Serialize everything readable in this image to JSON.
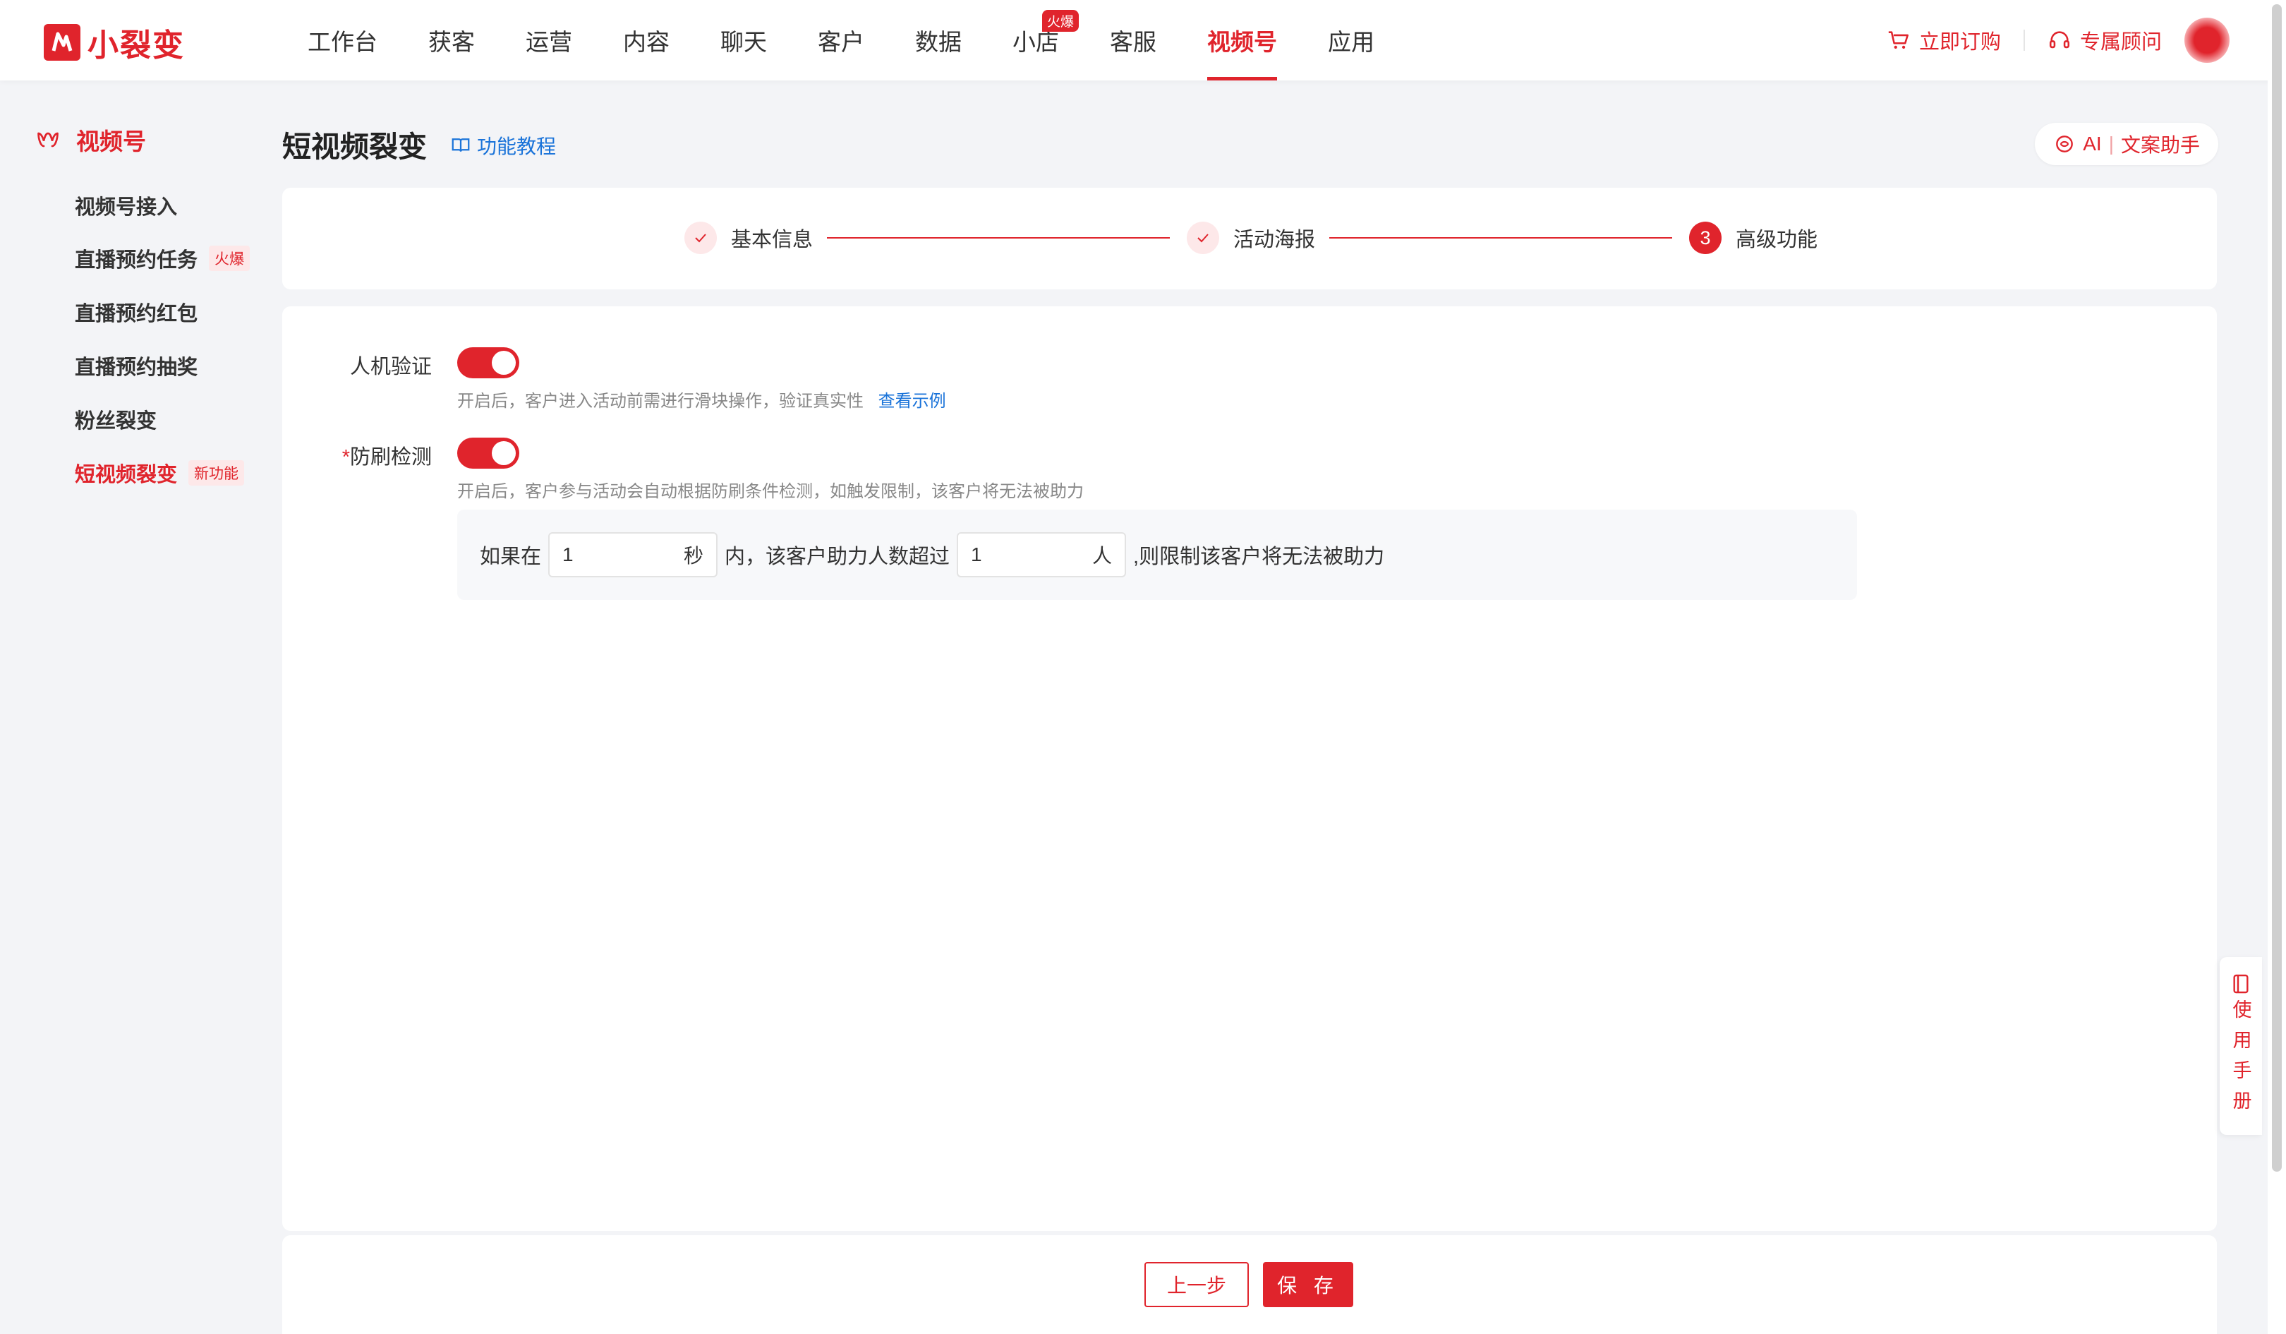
{
  "brand": {
    "name": "小裂变",
    "color": "#e0242c"
  },
  "nav": {
    "items": [
      "工作台",
      "获客",
      "运营",
      "内容",
      "聊天",
      "客户",
      "数据",
      "小店",
      "客服",
      "视频号",
      "应用"
    ],
    "active": "视频号",
    "shop_badge": "火爆"
  },
  "header": {
    "buy_label": "立即订购",
    "advisor_label": "专属顾问"
  },
  "sidebar": {
    "title": "视频号",
    "items": [
      {
        "label": "视频号接入",
        "tag": ""
      },
      {
        "label": "直播预约任务",
        "tag": "火爆"
      },
      {
        "label": "直播预约红包",
        "tag": ""
      },
      {
        "label": "直播预约抽奖",
        "tag": ""
      },
      {
        "label": "粉丝裂变",
        "tag": ""
      },
      {
        "label": "短视频裂变",
        "tag": "新功能"
      }
    ],
    "active_index": 5
  },
  "page": {
    "title": "短视频裂变",
    "tutorial_label": "功能教程",
    "ai_label": "AI",
    "ai_tool": "文案助手"
  },
  "steps": [
    {
      "label": "基本信息",
      "status": "done"
    },
    {
      "label": "活动海报",
      "status": "done"
    },
    {
      "label": "高级功能",
      "status": "current",
      "number": "3"
    }
  ],
  "form": {
    "captcha": {
      "label": "人机验证",
      "enabled": true,
      "hint": "开启后，客户进入活动前需进行滑块操作，验证真实性",
      "hint_link": "查看示例"
    },
    "anti_fraud": {
      "required_mark": "*",
      "label": "防刷检测",
      "enabled": true,
      "hint": "开启后，客户参与活动会自动根据防刷条件检测，如触发限制，该客户将无法被助力"
    },
    "rule": {
      "prefix": "如果在",
      "seconds_value": "1",
      "seconds_unit": "秒",
      "middle": "内，该客户助力人数超过",
      "people_value": "1",
      "people_unit": "人",
      "suffix": ",则限制该客户将无法被助力"
    }
  },
  "footer": {
    "prev_label": "上一步",
    "save_label": "保 存"
  },
  "manual_label": "使用手册"
}
